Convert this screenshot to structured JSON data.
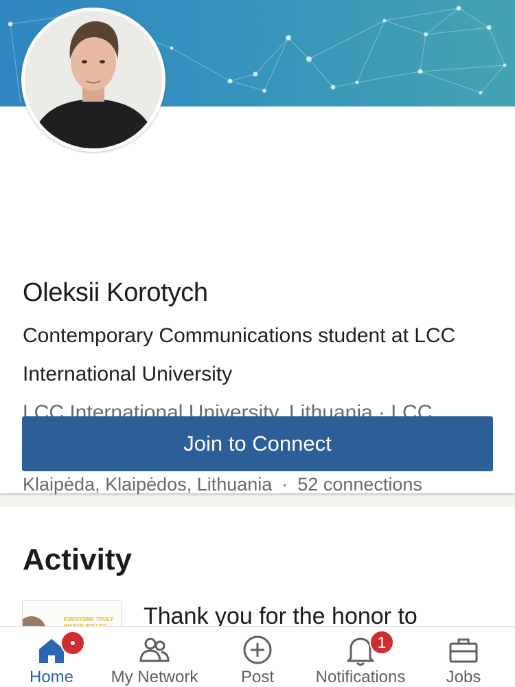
{
  "profile": {
    "name": "Oleksii Korotych",
    "headline": "Contemporary Communications student at LCC International University",
    "education": "LCC International University, Lithuania · LCC International University, Lithuania",
    "location": "Klaipėda, Klaipėdos, Lithuania",
    "separator": "·",
    "connections": "52 connections",
    "connect_button": "Join to Connect"
  },
  "activity": {
    "title": "Activity",
    "post_title": "Thank you for the honor to",
    "thumb_text": "EVERYONE TRULY WANTS YOU TO SUCCEED"
  },
  "nav": {
    "items": [
      {
        "label": "Home",
        "icon": "home-icon",
        "active": true
      },
      {
        "label": "My Network",
        "icon": "my-network-icon"
      },
      {
        "label": "Post",
        "icon": "post-icon"
      },
      {
        "label": "Notifications",
        "icon": "bell-icon",
        "badge": "1"
      },
      {
        "label": "Jobs",
        "icon": "briefcase-icon"
      }
    ]
  },
  "colors": {
    "accent": "#2c5f97",
    "active_nav": "#2a66b3",
    "badge": "#cf2d30",
    "cover_start": "#2f86c0",
    "cover_end": "#44a3b2"
  }
}
